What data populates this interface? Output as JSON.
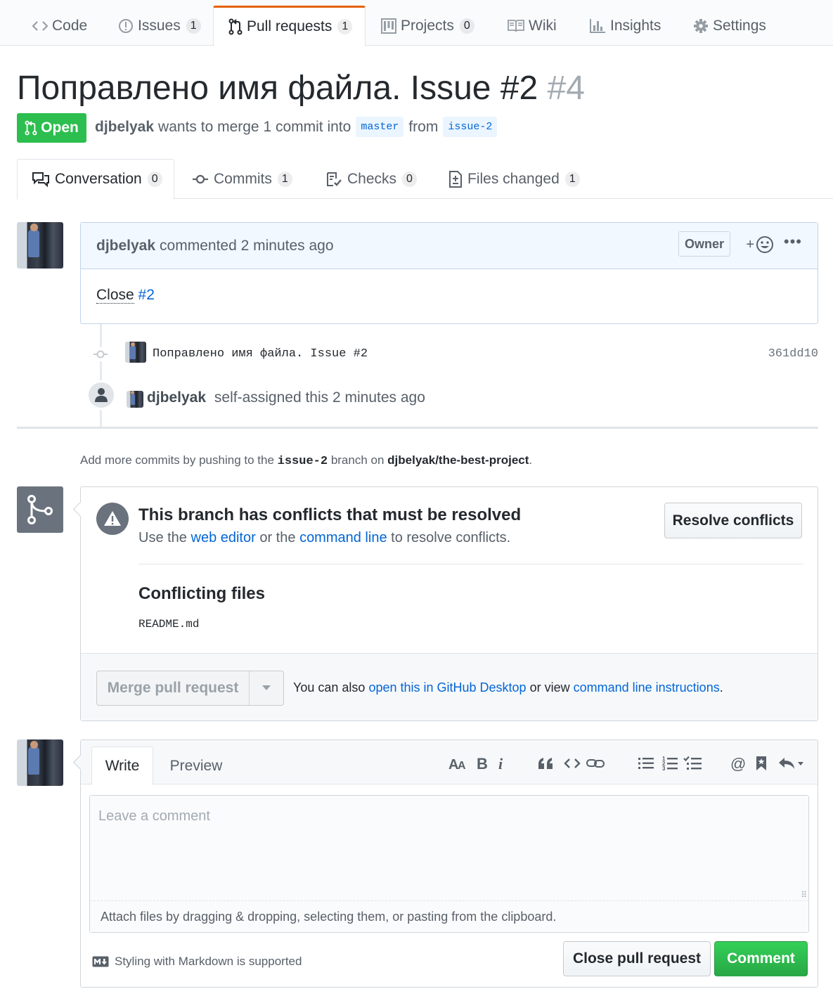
{
  "repo_nav": {
    "tabs": [
      {
        "label": "Code",
        "counter": "",
        "icon": "code-icon",
        "selected": false
      },
      {
        "label": "Issues",
        "counter": "1",
        "icon": "issue-opened-icon",
        "selected": false
      },
      {
        "label": "Pull requests",
        "counter": "1",
        "icon": "git-pull-request-icon",
        "selected": true
      },
      {
        "label": "Projects",
        "counter": "0",
        "icon": "project-icon",
        "selected": false
      },
      {
        "label": "Wiki",
        "counter": "",
        "icon": "book-icon",
        "selected": false
      },
      {
        "label": "Insights",
        "counter": "",
        "icon": "graph-icon",
        "selected": false
      },
      {
        "label": "Settings",
        "counter": "",
        "icon": "gear-icon",
        "selected": false
      }
    ]
  },
  "pr": {
    "title": "Поправлено имя файла. Issue #2",
    "number": "#4",
    "state": "Open",
    "author": "djbelyak",
    "merge_text": "wants to merge 1 commit into",
    "base_branch": "master",
    "from_text": "from",
    "head_branch": "issue-2"
  },
  "pr_tabs": [
    {
      "label": "Conversation",
      "counter": "0",
      "icon": "comment-discussion-icon"
    },
    {
      "label": "Commits",
      "counter": "1",
      "icon": "git-commit-icon"
    },
    {
      "label": "Checks",
      "counter": "0",
      "icon": "checklist-icon"
    },
    {
      "label": "Files changed",
      "counter": "1",
      "icon": "file-diff-icon"
    }
  ],
  "comment": {
    "author": "djbelyak",
    "action": "commented 2 minutes ago",
    "owner_label": "Owner",
    "reaction_plus": "+",
    "more": "•••",
    "body_text": "Close",
    "body_link": "#2"
  },
  "timeline": {
    "commit_message": "Поправлено имя файла. Issue #2",
    "commit_sha": "361dd10",
    "event_author": "djbelyak",
    "event_text": "self-assigned this 2 minutes ago"
  },
  "push_hint": {
    "prefix": "Add more commits by pushing to the",
    "branch": "issue-2",
    "middle": "branch on",
    "repo": "djbelyak/the-best-project",
    "suffix": "."
  },
  "merge": {
    "conflict_title": "This branch has conflicts that must be resolved",
    "sub_prefix": "Use the",
    "web_editor": "web editor",
    "sub_middle": "or the",
    "command_line": "command line",
    "sub_suffix": "to resolve conflicts.",
    "resolve_button": "Resolve conflicts",
    "conflicting_title": "Conflicting files",
    "files": [
      "README.md"
    ],
    "merge_button": "Merge pull request",
    "alt_prefix": "You can also",
    "alt_desktop": "open this in GitHub Desktop",
    "alt_middle": "or view",
    "alt_instructions": "command line instructions",
    "alt_suffix": "."
  },
  "editor": {
    "tab_write": "Write",
    "tab_preview": "Preview",
    "toolbar": [
      "text-size-icon",
      "bold-icon",
      "italic-icon",
      "quote-icon",
      "code-icon",
      "link-icon",
      "list-unordered-icon",
      "list-ordered-icon",
      "tasklist-icon",
      "mention-icon",
      "bookmark-icon",
      "reply-icon"
    ],
    "placeholder": "Leave a comment",
    "attach_text": "Attach files by dragging & dropping, selecting them, or pasting from the clipboard.",
    "markdown_hint": "Styling with Markdown is supported",
    "close_button": "Close pull request",
    "comment_button": "Comment"
  },
  "colors": {
    "open_green": "#2cbe4e",
    "link_blue": "#0366d6",
    "tab_accent": "#e36209",
    "comment_header": "#f1f8ff"
  }
}
